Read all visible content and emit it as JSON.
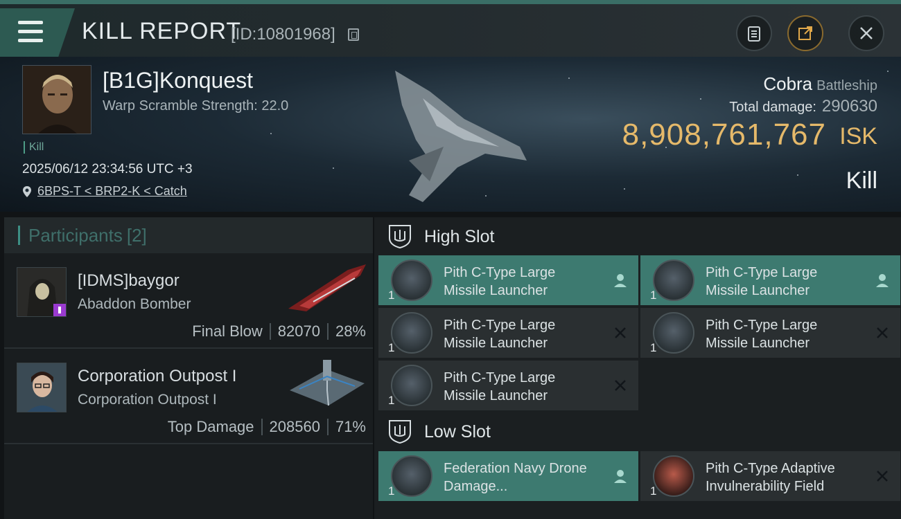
{
  "header": {
    "title": "KILL REPORT",
    "report_id": "[ID:10801968]"
  },
  "victim": {
    "name": "[B1G]Konquest",
    "warp_scramble": "Warp Scramble Strength: 22.0",
    "tag": "Kill",
    "datetime": "2025/06/12 23:34:56 UTC +3",
    "location": "6BPS-T < BRP2-K < Catch",
    "ship_name": "Cobra",
    "ship_class": "Battleship",
    "total_damage_label": "Total damage:",
    "total_damage": "290630",
    "isk_value": "8,908,761,767",
    "isk_label": "ISK",
    "result": "Kill"
  },
  "participants": {
    "title": "Participants",
    "count": "[2]",
    "list": [
      {
        "name": "[IDMS]baygor",
        "ship": "Abaddon Bomber",
        "role": "Final Blow",
        "damage": "82070",
        "percent": "28%"
      },
      {
        "name": "Corporation Outpost I",
        "ship": "Corporation Outpost I",
        "role": "Top Damage",
        "damage": "208560",
        "percent": "71%"
      }
    ]
  },
  "slots": {
    "high": {
      "title": "High Slot",
      "items": [
        {
          "name": "Pith C-Type Large Missile Launcher",
          "qty": "1",
          "status": "dropped"
        },
        {
          "name": "Pith C-Type Large Missile Launcher",
          "qty": "1",
          "status": "dropped"
        },
        {
          "name": "Pith C-Type Large Missile Launcher",
          "qty": "1",
          "status": "destroyed"
        },
        {
          "name": "Pith C-Type Large Missile Launcher",
          "qty": "1",
          "status": "destroyed"
        },
        {
          "name": "Pith C-Type Large Missile Launcher",
          "qty": "1",
          "status": "destroyed"
        }
      ]
    },
    "low": {
      "title": "Low Slot",
      "items": [
        {
          "name": "Federation Navy Drone Damage...",
          "qty": "1",
          "status": "dropped"
        },
        {
          "name": "Pith C-Type Adaptive Invulnerability Field",
          "qty": "1",
          "status": "destroyed"
        }
      ]
    }
  },
  "colors": {
    "accent": "#3d7a70",
    "isk": "#e5b96a"
  }
}
